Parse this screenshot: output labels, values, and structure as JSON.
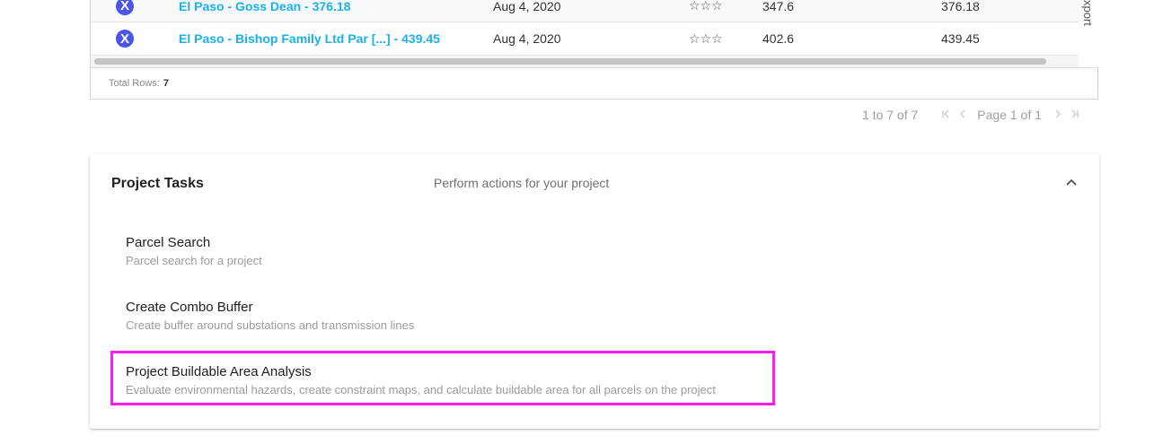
{
  "grid": {
    "rows": [
      {
        "name": "El Paso - Goss Dean - 376.18",
        "date": "Aug 4, 2020",
        "stars": "☆☆☆",
        "col_a": "347.6",
        "col_b": "376.18",
        "icon": "x-circle-icon"
      },
      {
        "name": "El Paso - Bishop Family Ltd Par [...] - 439.45",
        "date": "Aug 4, 2020",
        "stars": "☆☆☆",
        "col_a": "402.6",
        "col_b": "439.45",
        "icon": "x-circle-icon"
      }
    ],
    "side_tab_label": "xport",
    "footer_label": "Total Rows:",
    "footer_count": "7"
  },
  "pagination": {
    "range": "1 to 7 of 7",
    "page_label": "Page 1 of 1"
  },
  "tasks_card": {
    "title": "Project Tasks",
    "subtitle": "Perform actions for your project",
    "items": [
      {
        "title": "Parcel Search",
        "description": "Parcel search for a project"
      },
      {
        "title": "Create Combo Buffer",
        "description": "Create buffer around substations and transmission lines"
      },
      {
        "title": "Project Buildable Area Analysis",
        "description": "Evaluate environmental hazards, create constraint maps, and calculate buildable area for all parcels on the project"
      }
    ]
  },
  "colors": {
    "link": "#19b1e6",
    "icon_badge": "#4a56e8",
    "highlight": "#ff1cf3"
  }
}
